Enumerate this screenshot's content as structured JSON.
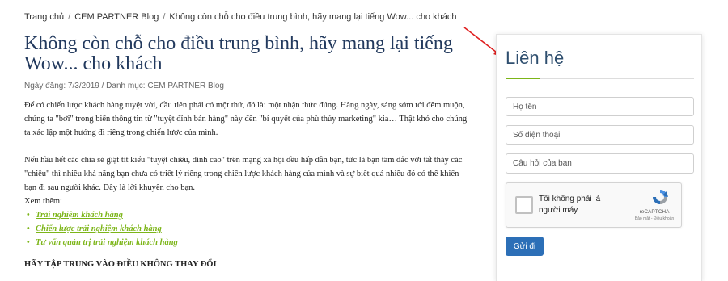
{
  "breadcrumb": {
    "home": "Trang chủ",
    "category": "CEM PARTNER Blog",
    "current": "Không còn chỗ cho điều trung bình, hãy mang lại tiếng Wow... cho khách",
    "separator": "/"
  },
  "article": {
    "title": "Không còn chỗ cho điều trung bình, hãy mang lại tiếng Wow... cho khách",
    "meta": "Ngày đăng: 7/3/2019 / Danh mục: CEM PARTNER Blog",
    "para1": "Để có chiến lược khách hàng tuyệt vời, đầu tiên phải có một thứ, đó là: một nhận thức đúng. Hàng ngày, sáng sớm tới đêm muộn, chúng ta \"bơi\" trong biển thông tin từ \"tuyệt đỉnh bán hàng\" này đến \"bí quyết của phù thủy marketing\" kia… Thật khó cho chúng ta xác lập một hướng đi riêng trong chiến lược của mình.",
    "para2": "Nếu hầu hết các chia sẻ giật tít kiểu \"tuyệt chiêu, đỉnh cao\" trên mạng xã hội đều hấp dẫn bạn, tức là bạn tâm đắc với tất thảy các \"chiêu\" thì nhiều khả năng bạn chưa có triết lý riêng trong chiến lược khách hàng của mình và sự biết quá nhiều đó có thể khiến bạn đi sau người khác. Đây là lời khuyên cho bạn.",
    "see_more": "Xem thêm:",
    "links": [
      " Trải nghiệm khách hàng",
      " Chiến lược trải nghiệm khách hàng",
      " Tư vấn quản trị trải nghiệm khách hàng"
    ],
    "heading": "HÃY TẬP TRUNG VÀO ĐIỀU KHÔNG THAY ĐỔI"
  },
  "contact": {
    "title": "Liên hệ",
    "name_placeholder": "Họ tên",
    "phone_placeholder": "Số điện thoại",
    "question_placeholder": "Câu hỏi của bạn",
    "captcha_label": "Tôi không phải là người máy",
    "captcha_brand": "reCAPTCHA",
    "captcha_links": "Bảo mật - Điều khoản",
    "submit_label": "Gửi đi"
  },
  "colors": {
    "title": "#233a5e",
    "link_green": "#7cb518",
    "button_blue": "#2c6fb7",
    "arrow_red": "#e02020"
  }
}
